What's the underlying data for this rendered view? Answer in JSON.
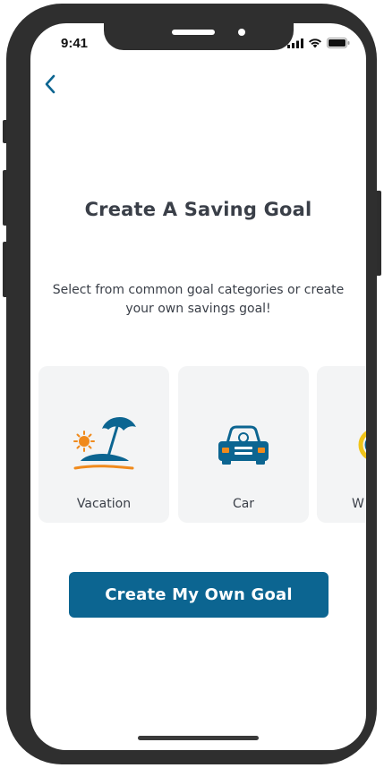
{
  "status_bar": {
    "time": "9:41"
  },
  "nav": {
    "back_icon": "chevron-left-icon"
  },
  "page": {
    "title": "Create A Saving Goal",
    "subtitle": "Select from common goal categories or create your own savings goal!"
  },
  "categories": [
    {
      "label": "Vacation",
      "icon": "beach-umbrella-icon"
    },
    {
      "label": "Car",
      "icon": "car-icon"
    },
    {
      "label": "W",
      "icon": "ring-icon"
    }
  ],
  "cta": {
    "label": "Create My Own Goal"
  },
  "colors": {
    "accent": "#0c6591",
    "orange": "#f08a1c",
    "text": "#3a3f48",
    "card_bg": "#f3f4f5"
  }
}
